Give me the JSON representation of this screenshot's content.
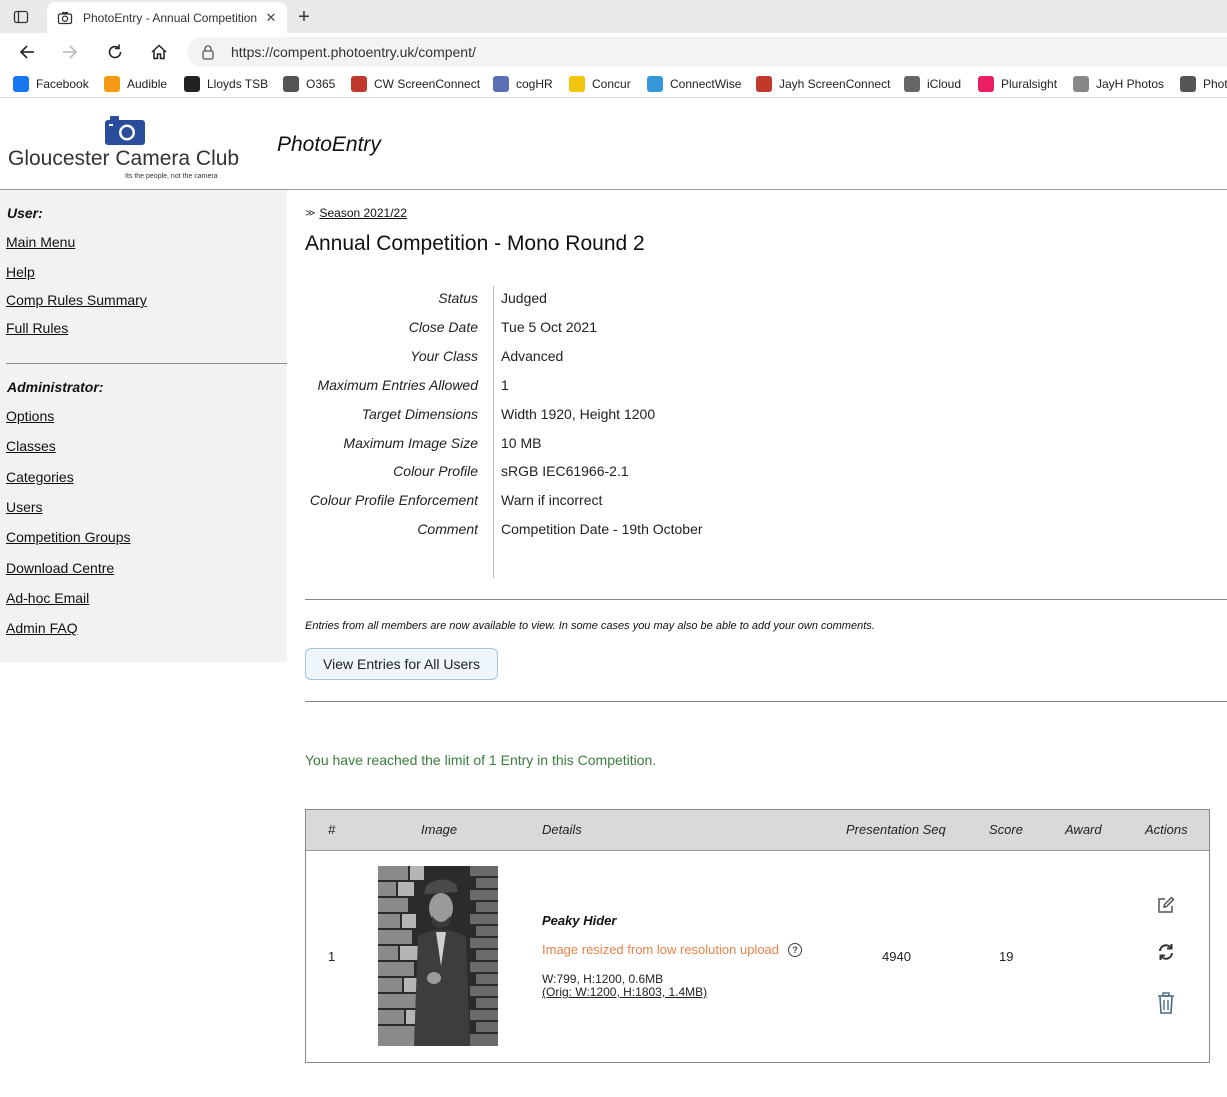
{
  "browser": {
    "tab_title": "PhotoEntry - Annual Competition",
    "url": "https://compent.photoentry.uk/compent/",
    "bookmarks": [
      {
        "label": "Facebook",
        "icon": "facebook-icon",
        "color": "#1877f2"
      },
      {
        "label": "Audible",
        "icon": "audible-icon",
        "color": "#f39c12"
      },
      {
        "label": "Lloyds TSB",
        "icon": "horse-icon",
        "color": "#222222"
      },
      {
        "label": "O365",
        "icon": "document-icon",
        "color": "#555555"
      },
      {
        "label": "CW ScreenConnect",
        "icon": "screenconnect-icon",
        "color": "#c0392b"
      },
      {
        "label": "cogHR",
        "icon": "hr-icon",
        "color": "#5b6fb5"
      },
      {
        "label": "Concur",
        "icon": "concur-icon",
        "color": "#f1c40f"
      },
      {
        "label": "ConnectWise",
        "icon": "connectwise-icon",
        "color": "#3498db"
      },
      {
        "label": "Jayh ScreenConnect",
        "icon": "screenconnect-icon",
        "color": "#c0392b"
      },
      {
        "label": "iCloud",
        "icon": "apple-icon",
        "color": "#666666"
      },
      {
        "label": "Pluralsight",
        "icon": "pluralsight-icon",
        "color": "#e91e63"
      },
      {
        "label": "JayH Photos",
        "icon": "photos-icon",
        "color": "#888888"
      },
      {
        "label": "Phot",
        "icon": "photos-icon",
        "color": "#555555"
      }
    ]
  },
  "header": {
    "club_name": "Gloucester Camera Club",
    "club_tagline": "Its the people, not the camera",
    "site_title": "PhotoEntry"
  },
  "sidebar": {
    "user_heading": "User:",
    "user_links": [
      "Main Menu",
      "Help",
      "Comp Rules Summary",
      "Full Rules"
    ],
    "admin_heading": "Administrator:",
    "admin_links": [
      "Options",
      "Classes",
      "Categories",
      "Users",
      "Competition Groups",
      "Download Centre",
      "Ad-hoc Email",
      "Admin FAQ"
    ]
  },
  "main": {
    "breadcrumb": "Season 2021/22",
    "title": "Annual Competition - Mono Round 2",
    "details": [
      {
        "label": "Status",
        "value": "Judged"
      },
      {
        "label": "Close Date",
        "value": "Tue 5 Oct 2021"
      },
      {
        "label": "Your Class",
        "value": "Advanced"
      },
      {
        "label": "Maximum Entries Allowed",
        "value": "1"
      },
      {
        "label": "Target Dimensions",
        "value": "Width 1920, Height 1200"
      },
      {
        "label": "Maximum Image Size",
        "value": "10 MB"
      },
      {
        "label": "Colour Profile",
        "value": "sRGB IEC61966-2.1"
      },
      {
        "label": "Colour Profile Enforcement",
        "value": "Warn if incorrect"
      },
      {
        "label": "Comment",
        "value": "Competition Date - 19th October"
      }
    ],
    "notice": "Entries from all members are now available to view. In some cases you may also be able to add your own comments.",
    "view_button": "View Entries for All Users",
    "limit_message": "You have reached the limit of 1 Entry in this Competition."
  },
  "entries": {
    "headers": {
      "num": "#",
      "image": "Image",
      "details": "Details",
      "seq": "Presentation Seq",
      "score": "Score",
      "award": "Award",
      "actions": "Actions"
    },
    "rows": [
      {
        "num": "1",
        "title": "Peaky Hider",
        "warning": "Image resized from low resolution upload",
        "dimensions": "W:799, H:1200, 0.6MB",
        "original": "(Orig: W:1200, H:1803, 1.4MB)",
        "seq": "4940",
        "score": "19",
        "award": ""
      }
    ]
  },
  "colors": {
    "limit_green": "#3b7d3b",
    "warning_orange": "#e8824a",
    "logo_blue": "#2a4d9b",
    "sidebar_bg": "#f2f2f2",
    "table_header_bg": "#d9d9d9"
  }
}
